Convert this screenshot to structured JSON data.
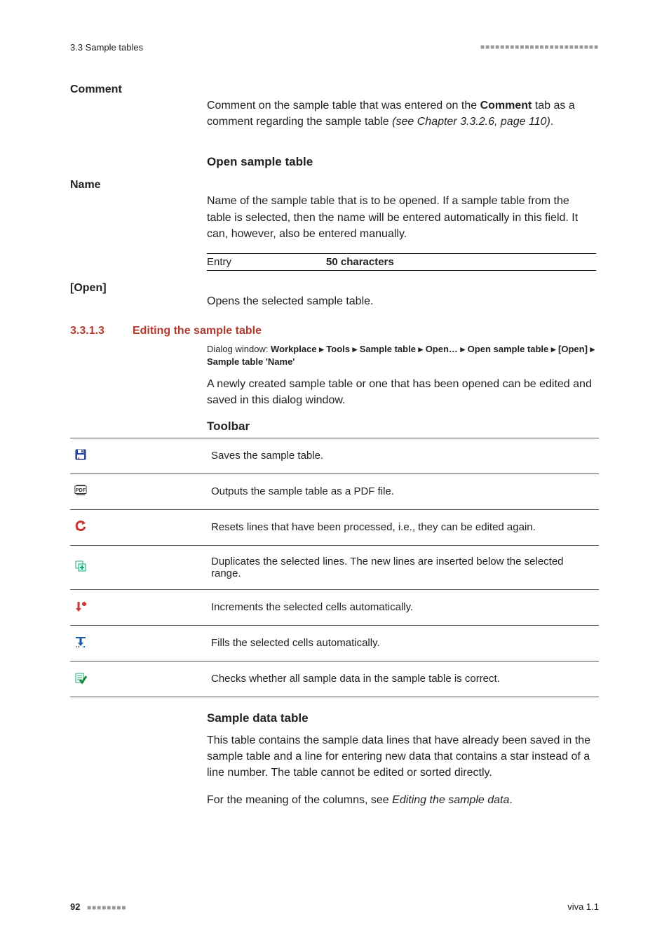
{
  "header": {
    "section_path": "3.3 Sample tables",
    "dots": "■■■■■■■■■■■■■■■■■■■■■■■■"
  },
  "comment": {
    "label": "Comment",
    "text_before": "Comment on the sample table that was entered on the ",
    "bold": "Comment",
    "text_mid": " tab as a comment regarding the sample table ",
    "italic": "(see Chapter 3.3.2.6, page 110)",
    "tail": "."
  },
  "open_sample_table": {
    "heading": "Open sample table",
    "name_label": "Name",
    "name_text": "Name of the sample table that is to be opened. If a sample table from the table is selected, then the name will be entered automatically in this field. It can, however, also be entered manually.",
    "entry_label": "Entry",
    "entry_value": "50 characters",
    "open_label": "[Open]",
    "open_text": "Opens the selected sample table."
  },
  "editing": {
    "num": "3.3.1.3",
    "title": "Editing the sample table",
    "dialog_prefix": "Dialog window: ",
    "dialog_path": "Workplace ▸ Tools ▸ Sample table ▸ Open… ▸ Open sample table ▸ [Open] ▸ Sample table 'Name'",
    "intro": "A newly created sample table or one that has been opened can be edited and saved in this dialog window.",
    "toolbar_heading": "Toolbar"
  },
  "toolbar": [
    {
      "icon": "save",
      "desc": "Saves the sample table."
    },
    {
      "icon": "pdf",
      "desc": "Outputs the sample table as a PDF file."
    },
    {
      "icon": "reset",
      "desc": "Resets lines that have been processed, i.e., they can be edited again."
    },
    {
      "icon": "duplicate",
      "desc": "Duplicates the selected lines. The new lines are inserted below the selected range."
    },
    {
      "icon": "increment",
      "desc": "Increments the selected cells automatically."
    },
    {
      "icon": "fill",
      "desc": "Fills the selected cells automatically."
    },
    {
      "icon": "check",
      "desc": "Checks whether all sample data in the sample table is correct."
    }
  ],
  "sample_data_table": {
    "heading": "Sample data table",
    "p1": "This table contains the sample data lines that have already been saved in the sample table and a line for entering new data that contains a star instead of a line number. The table cannot be edited or sorted directly.",
    "p2_before": "For the meaning of the columns, see ",
    "p2_italic": "Editing the sample data",
    "p2_tail": "."
  },
  "footer": {
    "page": "92",
    "dots": "■■■■■■■■",
    "version": "viva 1.1"
  }
}
